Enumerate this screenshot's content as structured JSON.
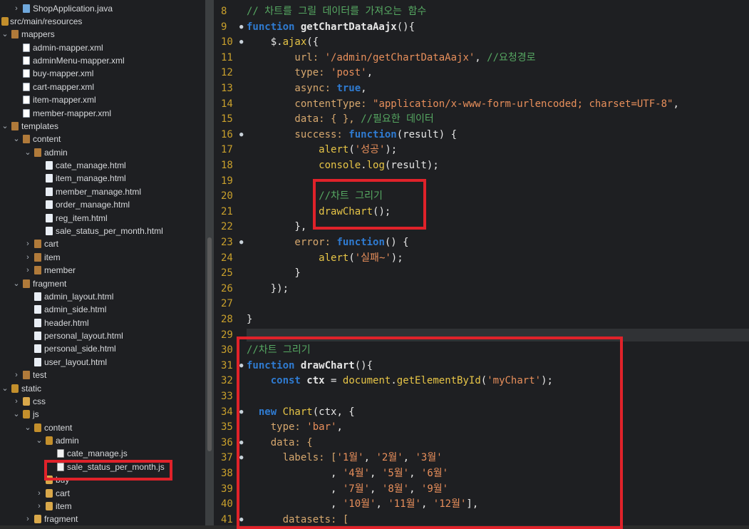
{
  "explorer": {
    "items": [
      {
        "label": "ShopApplication.java",
        "icon": "java-icon",
        "chevron": "›"
      },
      {
        "label": "src/main/resources",
        "icon": "folder-open-icon",
        "chevron": ""
      },
      {
        "label": "mappers",
        "icon": "package-icon",
        "chevron": "⌄"
      },
      {
        "label": "admin-mapper.xml",
        "icon": "xml-file-icon",
        "chevron": ""
      },
      {
        "label": "adminMenu-mapper.xml",
        "icon": "xml-file-icon",
        "chevron": ""
      },
      {
        "label": "buy-mapper.xml",
        "icon": "xml-file-icon",
        "chevron": ""
      },
      {
        "label": "cart-mapper.xml",
        "icon": "xml-file-icon",
        "chevron": ""
      },
      {
        "label": "item-mapper.xml",
        "icon": "xml-file-icon",
        "chevron": ""
      },
      {
        "label": "member-mapper.xml",
        "icon": "xml-file-icon",
        "chevron": ""
      },
      {
        "label": "templates",
        "icon": "package-icon",
        "chevron": "⌄"
      },
      {
        "label": "content",
        "icon": "package-icon",
        "chevron": "⌄"
      },
      {
        "label": "admin",
        "icon": "package-icon",
        "chevron": "⌄"
      },
      {
        "label": "cate_manage.html",
        "icon": "html-file-icon",
        "chevron": ""
      },
      {
        "label": "item_manage.html",
        "icon": "html-file-icon",
        "chevron": ""
      },
      {
        "label": "member_manage.html",
        "icon": "html-file-icon",
        "chevron": ""
      },
      {
        "label": "order_manage.html",
        "icon": "html-file-icon",
        "chevron": ""
      },
      {
        "label": "reg_item.html",
        "icon": "html-file-icon",
        "chevron": ""
      },
      {
        "label": "sale_status_per_month.html",
        "icon": "html-file-icon",
        "chevron": ""
      },
      {
        "label": "cart",
        "icon": "package-icon",
        "chevron": "›"
      },
      {
        "label": "item",
        "icon": "package-icon",
        "chevron": "›"
      },
      {
        "label": "member",
        "icon": "package-icon",
        "chevron": "›"
      },
      {
        "label": "fragment",
        "icon": "package-icon",
        "chevron": "⌄"
      },
      {
        "label": "admin_layout.html",
        "icon": "html-file-icon",
        "chevron": ""
      },
      {
        "label": "admin_side.html",
        "icon": "html-file-icon",
        "chevron": ""
      },
      {
        "label": "header.html",
        "icon": "html-file-icon",
        "chevron": ""
      },
      {
        "label": "personal_layout.html",
        "icon": "html-file-icon",
        "chevron": ""
      },
      {
        "label": "personal_side.html",
        "icon": "html-file-icon",
        "chevron": ""
      },
      {
        "label": "user_layout.html",
        "icon": "html-file-icon",
        "chevron": ""
      },
      {
        "label": "test",
        "icon": "package-icon",
        "chevron": "›"
      },
      {
        "label": "static",
        "icon": "folder-open-icon",
        "chevron": "⌄"
      },
      {
        "label": "css",
        "icon": "folder-icon",
        "chevron": "›"
      },
      {
        "label": "js",
        "icon": "folder-open-icon",
        "chevron": "⌄"
      },
      {
        "label": "content",
        "icon": "folder-open-icon",
        "chevron": "⌄"
      },
      {
        "label": "admin",
        "icon": "folder-open-icon",
        "chevron": "⌄"
      },
      {
        "label": "cate_manage.js",
        "icon": "js-file-icon",
        "chevron": ""
      },
      {
        "label": "sale_status_per_month.js",
        "icon": "js-file-icon",
        "chevron": ""
      },
      {
        "label": "buy",
        "icon": "folder-icon",
        "chevron": ""
      },
      {
        "label": "cart",
        "icon": "folder-icon",
        "chevron": "›"
      },
      {
        "label": "item",
        "icon": "folder-icon",
        "chevron": "›"
      },
      {
        "label": "fragment",
        "icon": "folder-icon",
        "chevron": "›"
      }
    ]
  },
  "editor": {
    "lines": [
      {
        "n": "8",
        "tokens": [
          {
            "t": "// 차트를 그릴 데이터를 가져오는 함수",
            "c": "cm"
          }
        ]
      },
      {
        "n": "9",
        "fold": "●",
        "tokens": [
          {
            "t": "function ",
            "c": "kw"
          },
          {
            "t": "getChartDataAajx",
            "c": "ident"
          },
          {
            "t": "(){",
            "c": "plain"
          }
        ]
      },
      {
        "n": "10",
        "fold": "●",
        "tokens": [
          {
            "t": "    $.",
            "c": "plain"
          },
          {
            "t": "ajax",
            "c": "fn"
          },
          {
            "t": "({",
            "c": "plain"
          }
        ]
      },
      {
        "n": "11",
        "tokens": [
          {
            "t": "        url: ",
            "c": "prop"
          },
          {
            "t": "'/admin/getChartDataAajx'",
            "c": "str"
          },
          {
            "t": ", ",
            "c": "plain"
          },
          {
            "t": "//요청경로",
            "c": "cm"
          }
        ]
      },
      {
        "n": "12",
        "tokens": [
          {
            "t": "        type: ",
            "c": "prop"
          },
          {
            "t": "'post'",
            "c": "str"
          },
          {
            "t": ",",
            "c": "plain"
          }
        ]
      },
      {
        "n": "13",
        "tokens": [
          {
            "t": "        async: ",
            "c": "prop"
          },
          {
            "t": "true",
            "c": "kw"
          },
          {
            "t": ",",
            "c": "plain"
          }
        ]
      },
      {
        "n": "14",
        "tokens": [
          {
            "t": "        contentType: ",
            "c": "prop"
          },
          {
            "t": "\"application/x-www-form-urlencoded; charset=UTF-8\"",
            "c": "str"
          },
          {
            "t": ",",
            "c": "plain"
          }
        ]
      },
      {
        "n": "15",
        "tokens": [
          {
            "t": "        data: { }, ",
            "c": "prop"
          },
          {
            "t": "//필요한 데이터",
            "c": "cm"
          }
        ]
      },
      {
        "n": "16",
        "fold": "●",
        "tokens": [
          {
            "t": "        success: ",
            "c": "prop"
          },
          {
            "t": "function",
            "c": "kw"
          },
          {
            "t": "(result) {",
            "c": "plain"
          }
        ]
      },
      {
        "n": "17",
        "tokens": [
          {
            "t": "            ",
            "c": "plain"
          },
          {
            "t": "alert",
            "c": "fn"
          },
          {
            "t": "(",
            "c": "plain"
          },
          {
            "t": "'성공'",
            "c": "str"
          },
          {
            "t": ");",
            "c": "plain"
          }
        ]
      },
      {
        "n": "18",
        "tokens": [
          {
            "t": "            ",
            "c": "plain"
          },
          {
            "t": "console",
            "c": "fn"
          },
          {
            "t": ".",
            "c": "plain"
          },
          {
            "t": "log",
            "c": "fn"
          },
          {
            "t": "(result);",
            "c": "plain"
          }
        ]
      },
      {
        "n": "19",
        "tokens": []
      },
      {
        "n": "20",
        "tokens": [
          {
            "t": "            ",
            "c": "plain"
          },
          {
            "t": "//차트 그리기",
            "c": "cm"
          }
        ]
      },
      {
        "n": "21",
        "tokens": [
          {
            "t": "            ",
            "c": "plain"
          },
          {
            "t": "drawChart",
            "c": "fn"
          },
          {
            "t": "();",
            "c": "plain"
          }
        ]
      },
      {
        "n": "22",
        "tokens": [
          {
            "t": "        },",
            "c": "plain"
          }
        ]
      },
      {
        "n": "23",
        "fold": "●",
        "tokens": [
          {
            "t": "        error: ",
            "c": "prop"
          },
          {
            "t": "function",
            "c": "kw"
          },
          {
            "t": "() {",
            "c": "plain"
          }
        ]
      },
      {
        "n": "24",
        "tokens": [
          {
            "t": "            ",
            "c": "plain"
          },
          {
            "t": "alert",
            "c": "fn"
          },
          {
            "t": "(",
            "c": "plain"
          },
          {
            "t": "'실패~'",
            "c": "str"
          },
          {
            "t": ");",
            "c": "plain"
          }
        ]
      },
      {
        "n": "25",
        "tokens": [
          {
            "t": "        }",
            "c": "plain"
          }
        ]
      },
      {
        "n": "26",
        "tokens": [
          {
            "t": "    });",
            "c": "plain"
          }
        ]
      },
      {
        "n": "27",
        "tokens": []
      },
      {
        "n": "28",
        "tokens": [
          {
            "t": "}",
            "c": "plain"
          }
        ]
      },
      {
        "n": "29",
        "tokens": []
      },
      {
        "n": "30",
        "tokens": [
          {
            "t": "//차트 그리기",
            "c": "cm"
          }
        ]
      },
      {
        "n": "31",
        "fold": "●",
        "tokens": [
          {
            "t": "function ",
            "c": "kw"
          },
          {
            "t": "drawChart",
            "c": "ident"
          },
          {
            "t": "(){",
            "c": "plain"
          }
        ]
      },
      {
        "n": "32",
        "tokens": [
          {
            "t": "    ",
            "c": "plain"
          },
          {
            "t": "const ",
            "c": "kw"
          },
          {
            "t": "ctx",
            "c": "ident"
          },
          {
            "t": " = ",
            "c": "plain"
          },
          {
            "t": "document",
            "c": "fn"
          },
          {
            "t": ".",
            "c": "plain"
          },
          {
            "t": "getElementById",
            "c": "fn"
          },
          {
            "t": "(",
            "c": "plain"
          },
          {
            "t": "'myChart'",
            "c": "str"
          },
          {
            "t": ");",
            "c": "plain"
          }
        ]
      },
      {
        "n": "33",
        "tokens": []
      },
      {
        "n": "34",
        "fold": "●",
        "tokens": [
          {
            "t": "  ",
            "c": "plain"
          },
          {
            "t": "new ",
            "c": "kw"
          },
          {
            "t": "Chart",
            "c": "fn"
          },
          {
            "t": "(ctx, {",
            "c": "plain"
          }
        ]
      },
      {
        "n": "35",
        "tokens": [
          {
            "t": "    type: ",
            "c": "prop"
          },
          {
            "t": "'bar'",
            "c": "str"
          },
          {
            "t": ",",
            "c": "plain"
          }
        ]
      },
      {
        "n": "36",
        "fold": "●",
        "tokens": [
          {
            "t": "    data: {",
            "c": "prop"
          }
        ]
      },
      {
        "n": "37",
        "fold": "●",
        "tokens": [
          {
            "t": "      labels: [",
            "c": "prop"
          },
          {
            "t": "'1월'",
            "c": "str"
          },
          {
            "t": ", ",
            "c": "plain"
          },
          {
            "t": "'2월'",
            "c": "str"
          },
          {
            "t": ", ",
            "c": "plain"
          },
          {
            "t": "'3월'",
            "c": "str"
          }
        ]
      },
      {
        "n": "38",
        "tokens": [
          {
            "t": "              , ",
            "c": "plain"
          },
          {
            "t": "'4월'",
            "c": "str"
          },
          {
            "t": ", ",
            "c": "plain"
          },
          {
            "t": "'5월'",
            "c": "str"
          },
          {
            "t": ", ",
            "c": "plain"
          },
          {
            "t": "'6월'",
            "c": "str"
          }
        ]
      },
      {
        "n": "39",
        "tokens": [
          {
            "t": "              , ",
            "c": "plain"
          },
          {
            "t": "'7월'",
            "c": "str"
          },
          {
            "t": ", ",
            "c": "plain"
          },
          {
            "t": "'8월'",
            "c": "str"
          },
          {
            "t": ", ",
            "c": "plain"
          },
          {
            "t": "'9월'",
            "c": "str"
          }
        ]
      },
      {
        "n": "40",
        "tokens": [
          {
            "t": "              , ",
            "c": "plain"
          },
          {
            "t": "'10월'",
            "c": "str"
          },
          {
            "t": ", ",
            "c": "plain"
          },
          {
            "t": "'11월'",
            "c": "str"
          },
          {
            "t": ", ",
            "c": "plain"
          },
          {
            "t": "'12월'",
            "c": "str"
          },
          {
            "t": "],",
            "c": "plain"
          }
        ]
      },
      {
        "n": "41",
        "fold": "●",
        "tokens": [
          {
            "t": "      datasets: [",
            "c": "prop"
          }
        ]
      }
    ]
  },
  "colors": {
    "highlight": "#e0222a",
    "line_number": "#c9a02c",
    "keyword": "#2f7bd1",
    "string": "#e88f5b",
    "comment": "#56a862"
  }
}
